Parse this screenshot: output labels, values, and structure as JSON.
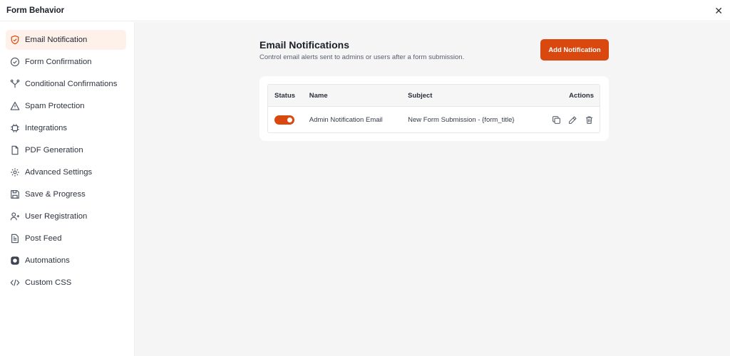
{
  "header": {
    "title": "Form Behavior",
    "close_icon": "close-icon"
  },
  "sidebar": {
    "items": [
      {
        "label": "Email Notification",
        "icon": "shield-icon",
        "active": true
      },
      {
        "label": "Form Confirmation",
        "icon": "check-circle-icon"
      },
      {
        "label": "Conditional Confirmations",
        "icon": "branch-icon"
      },
      {
        "label": "Spam Protection",
        "icon": "warning-icon"
      },
      {
        "label": "Integrations",
        "icon": "chip-icon"
      },
      {
        "label": "PDF Generation",
        "icon": "document-icon"
      },
      {
        "label": "Advanced Settings",
        "icon": "gear-icon"
      },
      {
        "label": "Save & Progress",
        "icon": "save-icon"
      },
      {
        "label": "User Registration",
        "icon": "user-plus-icon"
      },
      {
        "label": "Post Feed",
        "icon": "post-icon"
      },
      {
        "label": "Automations",
        "icon": "automation-icon"
      },
      {
        "label": "Custom CSS",
        "icon": "code-icon"
      }
    ]
  },
  "main": {
    "title": "Email Notifications",
    "subtitle": "Control email alerts sent to admins or users after a form submission.",
    "add_button": "Add Notification",
    "accent_color": "#d9480f",
    "table": {
      "headers": {
        "status": "Status",
        "name": "Name",
        "subject": "Subject",
        "actions": "Actions"
      },
      "rows": [
        {
          "status_on": true,
          "name": "Admin Notification Email",
          "subject": "New Form Submission - {form_title}"
        }
      ]
    }
  }
}
